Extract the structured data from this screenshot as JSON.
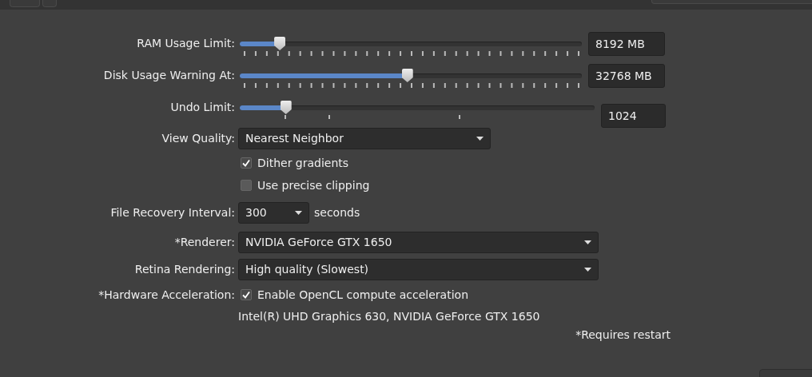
{
  "sliders": [
    {
      "label": "RAM Usage Limit:",
      "level": 0.117,
      "value": "8192 MB",
      "kind": "fine"
    },
    {
      "label": "Disk Usage Warning At:",
      "level": 0.49,
      "value": "32768 MB",
      "kind": "fine"
    },
    {
      "label": "Undo Limit:",
      "level": 0.13,
      "value": "1024",
      "kind": "coarse"
    }
  ],
  "view_quality": {
    "label": "View Quality:",
    "value": "Nearest Neighbor"
  },
  "checkboxes": [
    {
      "label": "Dither gradients",
      "checked": true
    },
    {
      "label": "Use precise clipping",
      "checked": false
    }
  ],
  "file_recovery": {
    "label": "File Recovery Interval:",
    "value": "300",
    "unit": "seconds"
  },
  "renderer": {
    "label": "*Renderer:",
    "value": "NVIDIA GeForce GTX 1650"
  },
  "retina_rendering": {
    "label": "Retina Rendering:",
    "value": "High quality (Slowest)"
  },
  "hardware_acceleration": {
    "label": "*Hardware Acceleration:",
    "checkbox_label": "Enable OpenCL compute acceleration",
    "checked": true,
    "devices": "Intel(R) UHD Graphics 630, NVIDIA GeForce GTX 1650"
  },
  "footnote": "*Requires restart"
}
